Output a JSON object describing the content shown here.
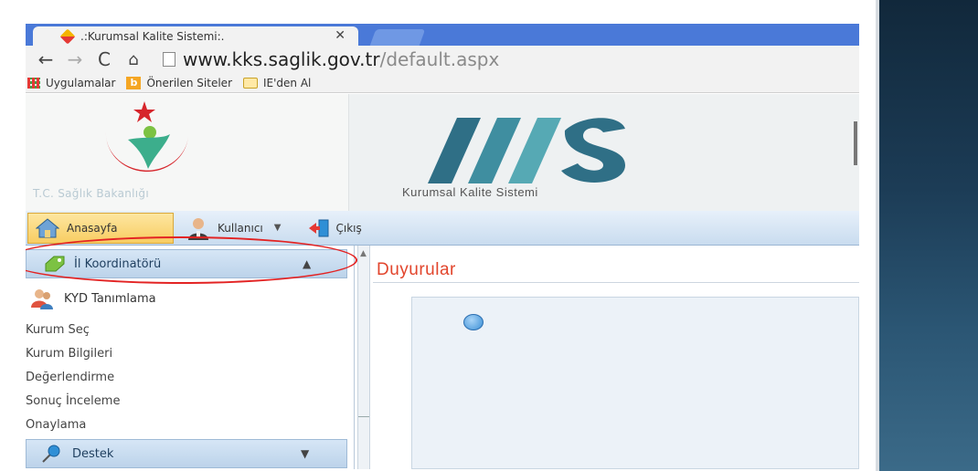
{
  "browser": {
    "tab_title": ".:Kurumsal Kalite Sistemi:.",
    "tab_close": "✕",
    "url_host": "www.kks.saglik.gov.tr",
    "url_path": "/default.aspx",
    "bookmarks": [
      {
        "label": "Uygulamalar"
      },
      {
        "label": "Önerilen Siteler"
      },
      {
        "label": "IE'den Al"
      }
    ]
  },
  "banner": {
    "ministry_name": "T.C. Sağlık Bakanlığı",
    "system_name": "Kurumsal Kalite Sistemi"
  },
  "menu": {
    "home": "Anasayfa",
    "user": "Kullanıcı",
    "exit": "Çıkış"
  },
  "sidebar": {
    "section_title": "İl Koordinatörü",
    "kyd": "KYD Tanımlama",
    "links": [
      "Kurum Seç",
      "Kurum Bilgileri",
      "Değerlendirme",
      "Sonuç İnceleme",
      "Onaylama"
    ],
    "support_title": "Destek"
  },
  "content": {
    "title": "Duyurular"
  },
  "colors": {
    "accent_red": "#e2452c",
    "tab_bar_blue": "#4a79d8",
    "home_button": "#f8cd62",
    "highlight_ring": "#e32323",
    "teal_logo": "#2f6f86"
  }
}
